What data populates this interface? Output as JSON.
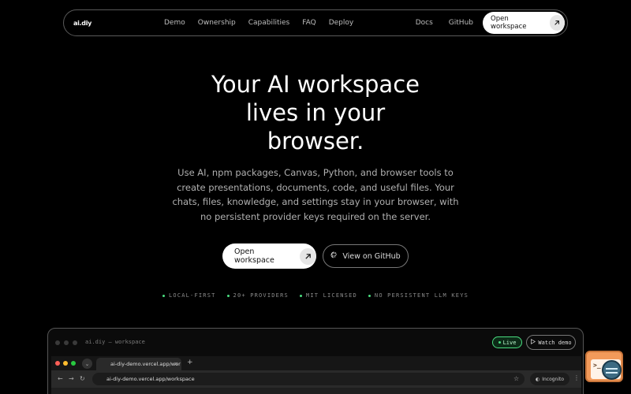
{
  "nav": {
    "logo": "ai.diy",
    "links": [
      "Demo",
      "Ownership",
      "Capabilities",
      "FAQ",
      "Deploy"
    ],
    "right_links": [
      "Docs",
      "GitHub"
    ],
    "cta_label": "Open workspace"
  },
  "hero": {
    "title_lines": [
      "Your AI workspace",
      "lives in your",
      "browser."
    ],
    "description_lines": [
      "Use AI, npm packages, Canvas, Python, and browser tools to",
      "create presentations, documents, code, and useful files. Your",
      "chats, files, knowledge, and settings stay in your browser, with",
      "no persistent provider keys required on the server."
    ],
    "primary_cta": "Open workspace",
    "secondary_cta": "View on GitHub"
  },
  "badges": [
    "LOCAL-FIRST",
    "20+ PROVIDERS",
    "MIT LICENSED",
    "NO PERSISTENT LLM KEYS"
  ],
  "preview": {
    "title": "ai.diy — workspace",
    "live_label": "Live",
    "watch_label": "Watch demo",
    "browser": {
      "tab_title": "ai-diy-demo.vercel.app/wor",
      "url": "ai-diy-demo.vercel.app/workspace",
      "incognito_label": "Incognito"
    }
  },
  "colors": {
    "background": "#000000",
    "accent_green": "#4ade80",
    "fab_orange": "#f29a5a"
  },
  "icons": {
    "arrow": "arrow-up-right-icon",
    "github": "github-icon",
    "play": "play-icon"
  }
}
